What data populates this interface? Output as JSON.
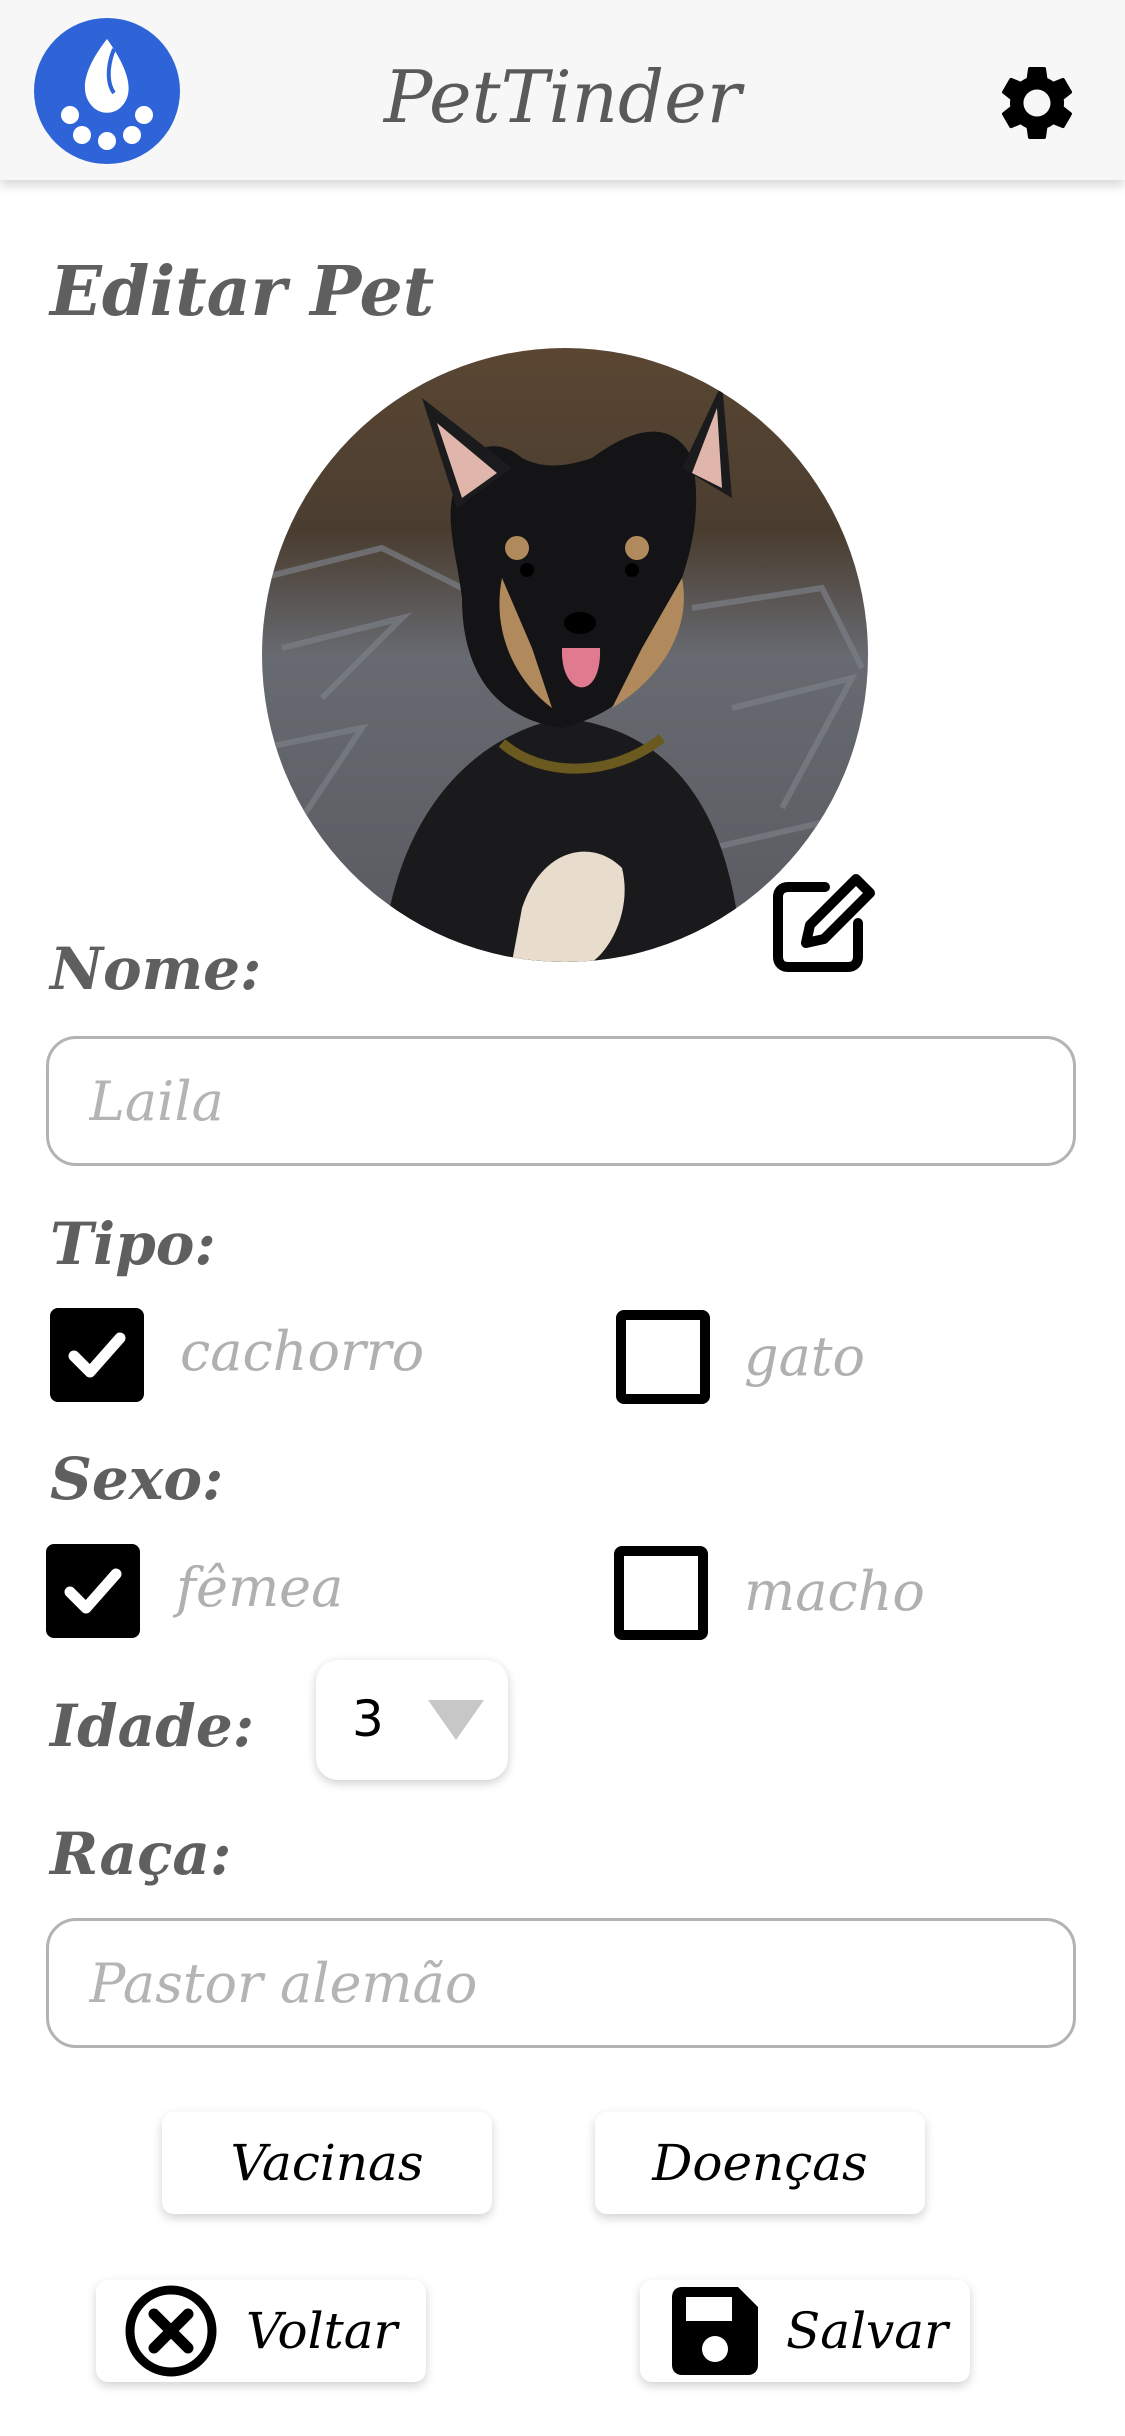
{
  "app": {
    "title": "PetTinder"
  },
  "icons": {
    "logo": "paw-logo-icon",
    "settings": "gear-icon",
    "edit": "edit-square-icon",
    "back": "close-circle-icon",
    "save": "floppy-disk-icon"
  },
  "colors": {
    "brand": "#2e64d8",
    "text": "#5f5f5f",
    "placeholder": "#b4b4b4"
  },
  "page": {
    "title": "Editar Pet"
  },
  "form": {
    "name_label": "Nome:",
    "name_placeholder": "Laila",
    "type_label": "Tipo:",
    "type_options": [
      {
        "label": "cachorro",
        "checked": true
      },
      {
        "label": "gato",
        "checked": false
      }
    ],
    "sex_label": "Sexo:",
    "sex_options": [
      {
        "label": "fêmea",
        "checked": true
      },
      {
        "label": "macho",
        "checked": false
      }
    ],
    "age_label": "Idade:",
    "age_value": "3",
    "breed_label": "Raça:",
    "breed_placeholder": "Pastor alemão"
  },
  "buttons": {
    "vaccines": "Vacinas",
    "diseases": "Doenças",
    "back": "Voltar",
    "save": "Salvar"
  }
}
